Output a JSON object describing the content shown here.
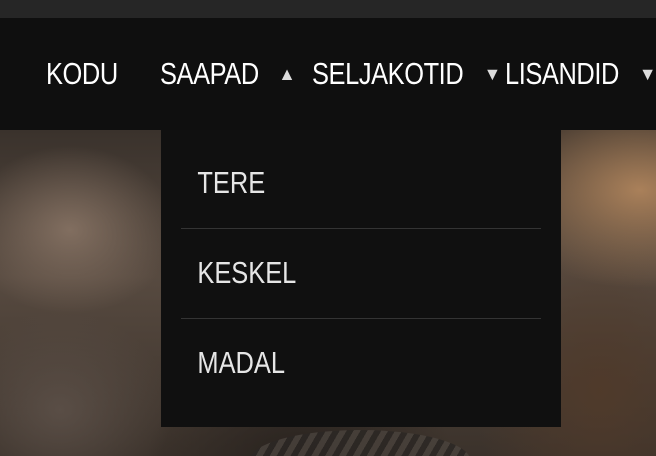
{
  "nav": {
    "items": [
      {
        "label": "KODU"
      },
      {
        "label": "SAAPAD",
        "caret": "▲"
      },
      {
        "label": "SELJAKOTID",
        "caret": "▼"
      },
      {
        "label": "LISANDID",
        "caret": "▼"
      }
    ]
  },
  "dropdown": {
    "items": [
      {
        "label": "TERE"
      },
      {
        "label": "KESKEL"
      },
      {
        "label": "MADAL"
      }
    ]
  },
  "icons": {
    "expanded_caret": "caret-up-icon",
    "collapsed_caret": "caret-down-icon"
  }
}
